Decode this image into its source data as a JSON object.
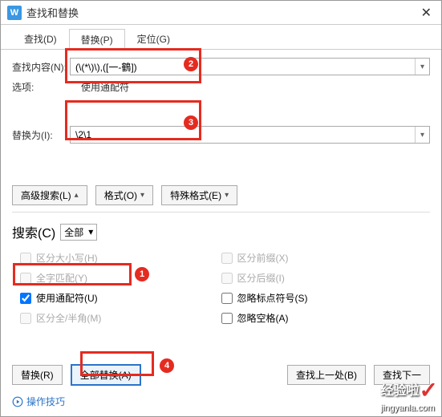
{
  "window": {
    "title": "查找和替换",
    "app_glyph": "W"
  },
  "tabs": {
    "find": "查找(D)",
    "replace": "替换(P)",
    "goto": "定位(G)"
  },
  "labels": {
    "find_what": "查找内容(N):",
    "options": "选项:",
    "options_value": "使用通配符",
    "replace_with": "替换为(I):",
    "search": "搜索(C)"
  },
  "fields": {
    "find_value": "(\\(*\\)\\),([一-鶴])",
    "replace_value": "\\2\\1",
    "search_scope": "全部"
  },
  "buttons": {
    "advanced": "高级搜索(L)",
    "format": "格式(O)",
    "special": "特殊格式(E)",
    "replace": "替换(R)",
    "replace_all": "全部替换(A)",
    "find_prev": "查找上一处(B)",
    "find_next": "查找下一",
    "close": "关闭"
  },
  "checks": {
    "match_case": "区分大小写(H)",
    "whole_word": "全字匹配(Y)",
    "use_wildcards": "使用通配符(U)",
    "half_full": "区分全/半角(M)",
    "match_prefix": "区分前缀(X)",
    "match_suffix": "区分后缀(I)",
    "ignore_punct": "忽略标点符号(S)",
    "ignore_space": "忽略空格(A)"
  },
  "tips": "操作技巧",
  "badges": {
    "b1": "1",
    "b2": "2",
    "b3": "3",
    "b4": "4"
  },
  "watermark": {
    "main": "经验啦",
    "sub": "jingyanla.com"
  }
}
